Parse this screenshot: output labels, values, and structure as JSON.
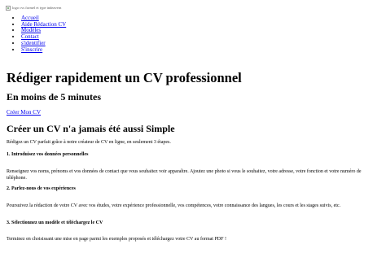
{
  "header": {
    "logo_alt": "logo cvs formel et type indeavern"
  },
  "nav": {
    "items": [
      {
        "label": "Accueil"
      },
      {
        "label": "Aide Rédaction CV"
      },
      {
        "label": "Modèles"
      },
      {
        "label": "Contact"
      },
      {
        "label": "s'identifier"
      },
      {
        "label": "S'inscrire"
      }
    ]
  },
  "hero": {
    "title": "Rédiger rapidement un CV professionnel",
    "subtitle": "En moins de 5 minutes",
    "cta_label": "Créer Mon CV"
  },
  "section": {
    "title": "Créer un CV n'a jamais été aussi Simple",
    "intro": "Rédigez un CV parfait grâce à notre créateur de CV en ligne, en seulement 3 étapes.",
    "steps": [
      {
        "title": "1. Introduisez vos données personnelles",
        "text": "Renseignez vos noms, prénoms et vos données de contact que vous souhaitez voir apparaître. Ajoutez une photo si vous le souhaitez, votre adresse, votre fonction et votre numéro de téléphone."
      },
      {
        "title": "2. Parlez-nous de vos expériences",
        "text": "Poursuivez la rédaction de votre CV avec vos études, votre expérience professionnelle, vos compétences, votre connaissance des langues, les cours et les stages suivis, etc."
      },
      {
        "title": "3. Sélectionnez un modèle et téléchargez le CV",
        "text": "Terminez en choisissant une mise en page parmi les exemples proposés et téléchargez votre CV au format PDF !"
      }
    ]
  }
}
